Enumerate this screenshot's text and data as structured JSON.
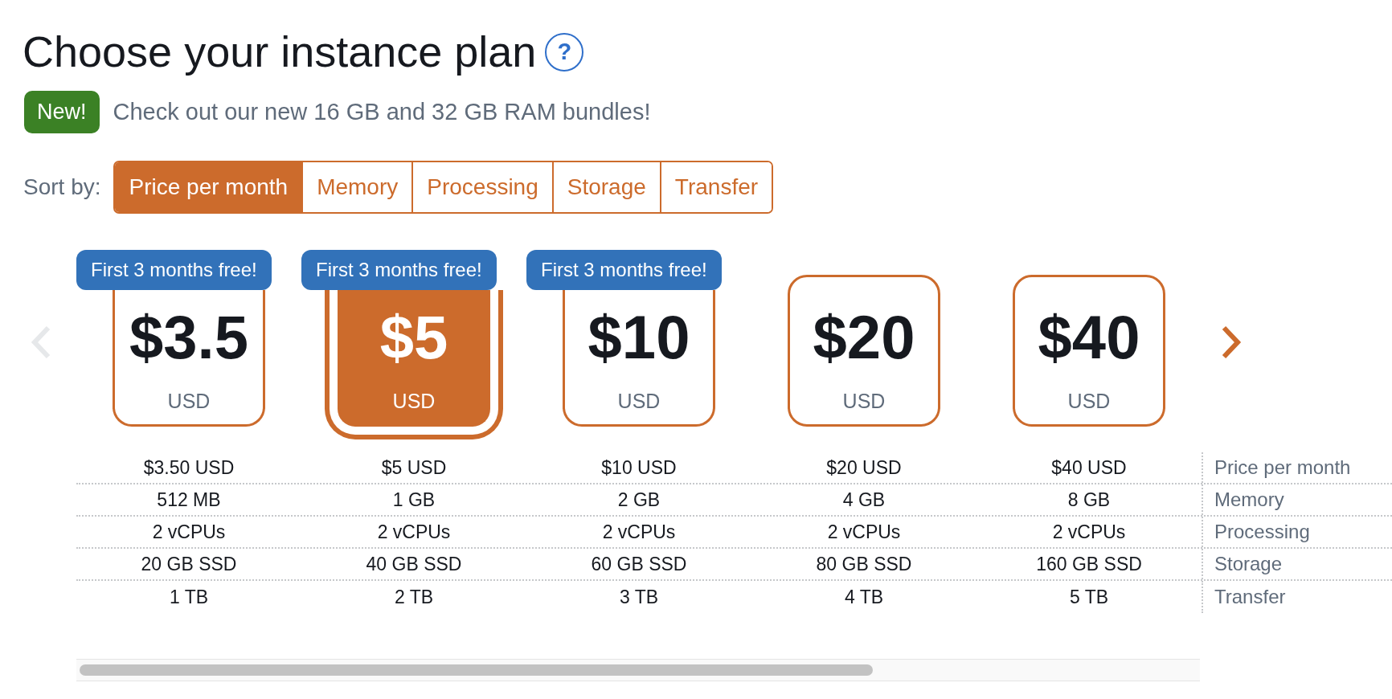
{
  "title": {
    "text": "Choose your instance plan",
    "help": "?"
  },
  "announcement": {
    "badge": "New!",
    "text": "Check out our new 16 GB and 32 GB RAM bundles!"
  },
  "sort": {
    "label": "Sort by:",
    "options": [
      {
        "label": "Price per month",
        "selected": true
      },
      {
        "label": "Memory",
        "selected": false
      },
      {
        "label": "Processing",
        "selected": false
      },
      {
        "label": "Storage",
        "selected": false
      },
      {
        "label": "Transfer",
        "selected": false
      }
    ]
  },
  "carousel": {
    "previous": {
      "disabled": true
    },
    "next": {
      "disabled": false
    }
  },
  "plans": [
    {
      "promo": "First 3 months free!",
      "price": "$3.5",
      "currency": "USD",
      "selected": false,
      "specs": [
        "$3.50 USD",
        "512 MB",
        "2 vCPUs",
        "20 GB SSD",
        "1 TB"
      ]
    },
    {
      "promo": "First 3 months free!",
      "price": "$5",
      "currency": "USD",
      "selected": true,
      "specs": [
        "$5 USD",
        "1 GB",
        "2 vCPUs",
        "40 GB SSD",
        "2 TB"
      ]
    },
    {
      "promo": "First 3 months free!",
      "price": "$10",
      "currency": "USD",
      "selected": false,
      "specs": [
        "$10 USD",
        "2 GB",
        "2 vCPUs",
        "60 GB SSD",
        "3 TB"
      ]
    },
    {
      "price": "$20",
      "currency": "USD",
      "selected": false,
      "specs": [
        "$20 USD",
        "4 GB",
        "2 vCPUs",
        "80 GB SSD",
        "4 TB"
      ]
    },
    {
      "price": "$40",
      "currency": "USD",
      "selected": false,
      "specs": [
        "$40 USD",
        "8 GB",
        "2 vCPUs",
        "160 GB SSD",
        "5 TB"
      ]
    }
  ],
  "spec_labels": [
    "Price per month",
    "Memory",
    "Processing",
    "Storage",
    "Transfer"
  ]
}
